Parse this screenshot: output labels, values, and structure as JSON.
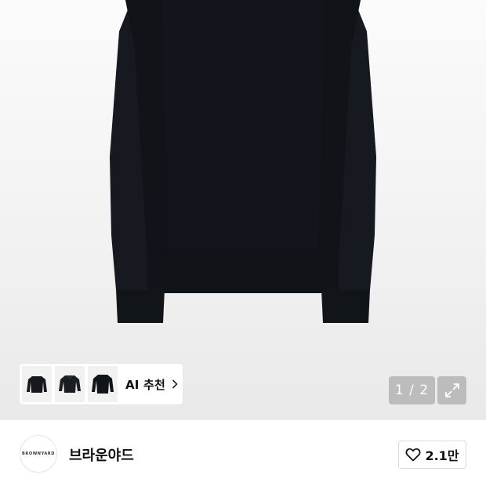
{
  "product": {
    "image_alt": "black knit sweater"
  },
  "ai_recommend": {
    "label": "AI 추천",
    "chevron_icon": "chevron-right-icon",
    "thumbnails": [
      "sweater-thumb-1",
      "sweater-thumb-2",
      "sweater-thumb-3"
    ]
  },
  "gallery": {
    "pager_text": "1 / 2",
    "expand_icon": "expand-icon"
  },
  "brand": {
    "logo_text": "BROWNYARD",
    "name": "브라운야드"
  },
  "like": {
    "icon": "heart-icon",
    "count": "2.1만"
  },
  "colors": {
    "sweater": "#13161b",
    "pager_bg": "#969696",
    "text": "#111111"
  }
}
